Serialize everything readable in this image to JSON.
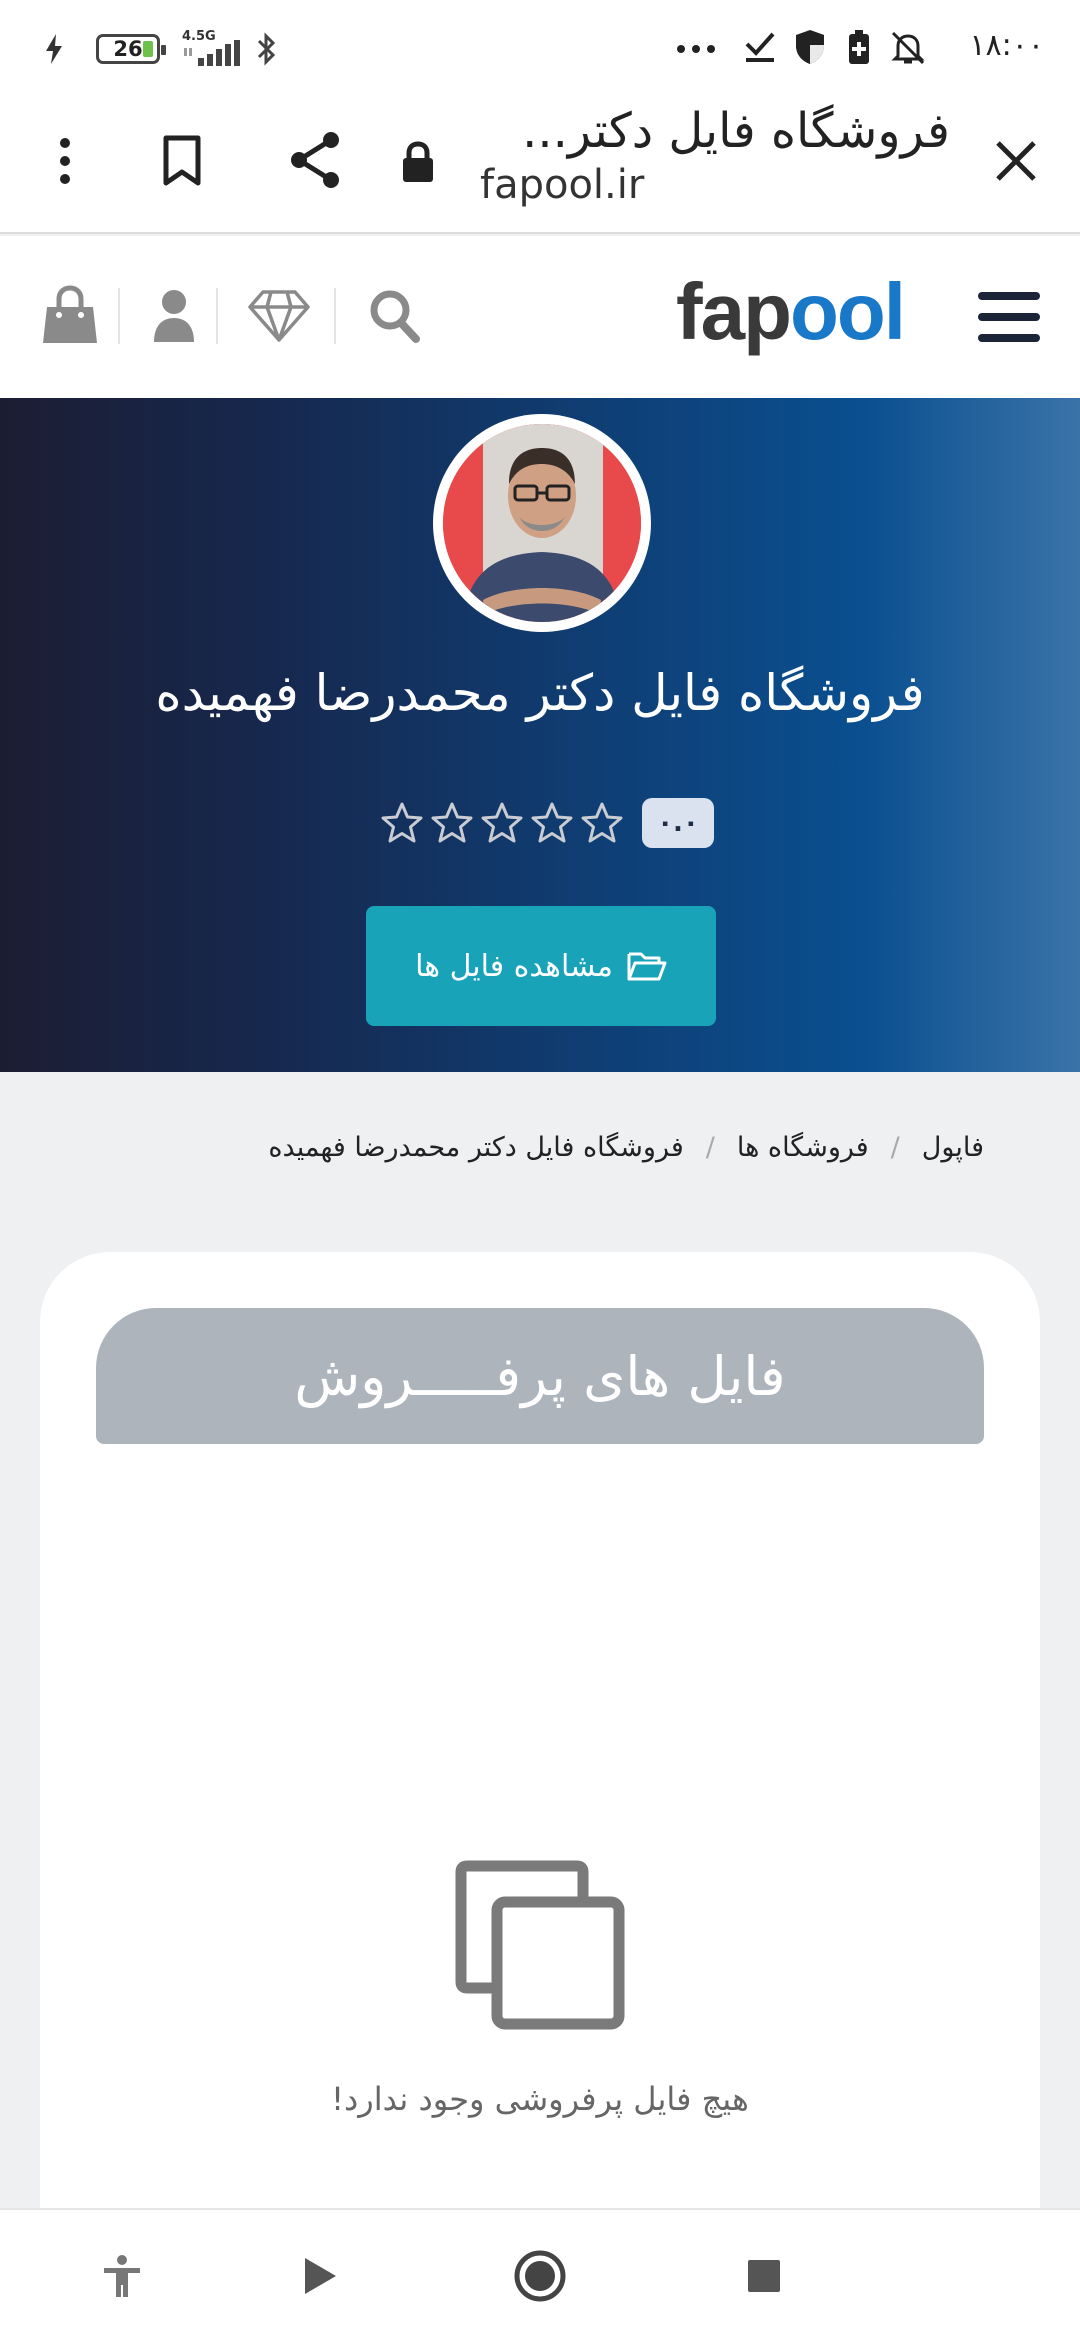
{
  "status_bar": {
    "battery_level": "26",
    "network_type": "4.5G",
    "clock": "۱۸:۰۰",
    "icons": [
      "charging-icon",
      "battery-icon",
      "signal-icon",
      "bluetooth-icon",
      "more-icon",
      "check-icon",
      "shield-icon",
      "battery-saver-icon",
      "bell-off-icon"
    ]
  },
  "browser": {
    "page_title": "فروشگاه فایل دکتر...",
    "url": "fapool.ir",
    "icons": [
      "close-icon",
      "lock-icon",
      "share-icon",
      "bookmark-icon",
      "menu-dots-icon"
    ]
  },
  "site_header": {
    "logo_part1": "fap",
    "logo_part2": "ool",
    "icons": [
      "hamburger-menu-icon",
      "search-icon",
      "diamond-icon",
      "user-icon",
      "shopping-bag-icon"
    ]
  },
  "hero": {
    "shop_title": "فروشگاه فایل دکتر محمدرضا فهمیده",
    "rating_value": "۰.۰",
    "rating_stars": 0,
    "rating_max": 5,
    "view_files_button": "مشاهده فایل ها"
  },
  "breadcrumb": {
    "items": [
      "فاپول",
      "فروشگاه ها",
      "فروشگاه فایل دکتر محمدرضا فهمیده"
    ],
    "separator": "/"
  },
  "bestsellers": {
    "title": "فایل های پرفـــــروش",
    "empty_message": "هیچ فایل پرفروشی وجود ندارد!"
  },
  "colors": {
    "accent_button": "#19a3b8",
    "logo_blue": "#1978c8",
    "card_header": "#adb4bc"
  }
}
